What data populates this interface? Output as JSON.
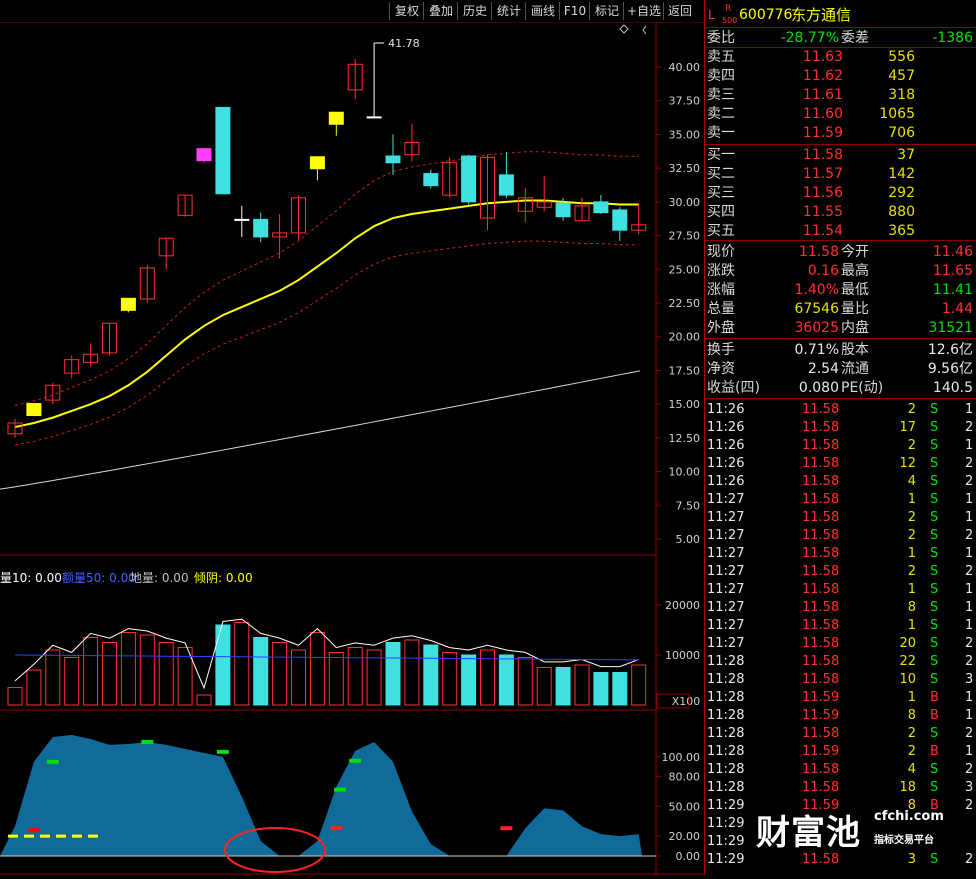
{
  "toolbar": {
    "items": [
      "复权",
      "叠加",
      "历史",
      "统计",
      "画线",
      "F10",
      "标记",
      "+自选",
      "返回"
    ]
  },
  "stock": {
    "level_badge": "L",
    "r_badge": "R",
    "sub_badge": "500",
    "code": "600776",
    "name": "东方通信"
  },
  "summary": {
    "weibi_label": "委比",
    "weibi_value": "-28.77%",
    "weicha_label": "委差",
    "weicha_value": "-1386"
  },
  "sell": [
    {
      "label": "卖五",
      "price": "11.63",
      "volume": "556"
    },
    {
      "label": "卖四",
      "price": "11.62",
      "volume": "457"
    },
    {
      "label": "卖三",
      "price": "11.61",
      "volume": "318"
    },
    {
      "label": "卖二",
      "price": "11.60",
      "volume": "1065"
    },
    {
      "label": "卖一",
      "price": "11.59",
      "volume": "706"
    }
  ],
  "buy": [
    {
      "label": "买一",
      "price": "11.58",
      "volume": "37"
    },
    {
      "label": "买二",
      "price": "11.57",
      "volume": "142"
    },
    {
      "label": "买三",
      "price": "11.56",
      "volume": "292"
    },
    {
      "label": "买四",
      "price": "11.55",
      "volume": "880"
    },
    {
      "label": "买五",
      "price": "11.54",
      "volume": "365"
    }
  ],
  "stats1": [
    {
      "l1": "现价",
      "v1": "11.58",
      "c1": "red",
      "l2": "今开",
      "v2": "11.46",
      "c2": "red"
    },
    {
      "l1": "涨跌",
      "v1": "0.16",
      "c1": "red",
      "l2": "最高",
      "v2": "11.65",
      "c2": "red"
    },
    {
      "l1": "涨幅",
      "v1": "1.40%",
      "c1": "red",
      "l2": "最低",
      "v2": "11.41",
      "c2": "green"
    },
    {
      "l1": "总量",
      "v1": "67546",
      "c1": "yellow",
      "l2": "量比",
      "v2": "1.44",
      "c2": "red"
    },
    {
      "l1": "外盘",
      "v1": "36025",
      "c1": "red",
      "l2": "内盘",
      "v2": "31521",
      "c2": "green"
    }
  ],
  "stats2": [
    {
      "l1": "换手",
      "v1": "0.71%",
      "l2": "股本",
      "v2": "12.6亿"
    },
    {
      "l1": "净资",
      "v1": "2.54",
      "l2": "流通",
      "v2": "9.56亿"
    },
    {
      "l1": "收益(四)",
      "v1": "0.080",
      "l2": "PE(动)",
      "v2": "140.5"
    }
  ],
  "ticks": [
    {
      "t": "11:26",
      "p": "11.58",
      "v": "2",
      "s": "S",
      "n": "1"
    },
    {
      "t": "11:26",
      "p": "11.58",
      "v": "17",
      "s": "S",
      "n": "2"
    },
    {
      "t": "11:26",
      "p": "11.58",
      "v": "2",
      "s": "S",
      "n": "1"
    },
    {
      "t": "11:26",
      "p": "11.58",
      "v": "12",
      "s": "S",
      "n": "2"
    },
    {
      "t": "11:26",
      "p": "11.58",
      "v": "4",
      "s": "S",
      "n": "2"
    },
    {
      "t": "11:27",
      "p": "11.58",
      "v": "1",
      "s": "S",
      "n": "1"
    },
    {
      "t": "11:27",
      "p": "11.58",
      "v": "2",
      "s": "S",
      "n": "1"
    },
    {
      "t": "11:27",
      "p": "11.58",
      "v": "2",
      "s": "S",
      "n": "2"
    },
    {
      "t": "11:27",
      "p": "11.58",
      "v": "1",
      "s": "S",
      "n": "1"
    },
    {
      "t": "11:27",
      "p": "11.58",
      "v": "2",
      "s": "S",
      "n": "2"
    },
    {
      "t": "11:27",
      "p": "11.58",
      "v": "1",
      "s": "S",
      "n": "1"
    },
    {
      "t": "11:27",
      "p": "11.58",
      "v": "8",
      "s": "S",
      "n": "1"
    },
    {
      "t": "11:27",
      "p": "11.58",
      "v": "1",
      "s": "S",
      "n": "1"
    },
    {
      "t": "11:27",
      "p": "11.58",
      "v": "20",
      "s": "S",
      "n": "2"
    },
    {
      "t": "11:28",
      "p": "11.58",
      "v": "22",
      "s": "S",
      "n": "2"
    },
    {
      "t": "11:28",
      "p": "11.58",
      "v": "10",
      "s": "S",
      "n": "3"
    },
    {
      "t": "11:28",
      "p": "11.59",
      "v": "1",
      "s": "B",
      "n": "1"
    },
    {
      "t": "11:28",
      "p": "11.59",
      "v": "8",
      "s": "B",
      "n": "1"
    },
    {
      "t": "11:28",
      "p": "11.58",
      "v": "2",
      "s": "S",
      "n": "2"
    },
    {
      "t": "11:28",
      "p": "11.59",
      "v": "2",
      "s": "B",
      "n": "1"
    },
    {
      "t": "11:28",
      "p": "11.58",
      "v": "4",
      "s": "S",
      "n": "2"
    },
    {
      "t": "11:28",
      "p": "11.58",
      "v": "18",
      "s": "S",
      "n": "3"
    },
    {
      "t": "11:29",
      "p": "11.59",
      "v": "8",
      "s": "B",
      "n": "2"
    },
    {
      "t": "11:29",
      "p": "",
      "v": "",
      "s": "",
      "n": ""
    },
    {
      "t": "11:29",
      "p": "",
      "v": "",
      "s": "",
      "n": ""
    },
    {
      "t": "11:29",
      "p": "11.58",
      "v": "3",
      "s": "S",
      "n": "2"
    }
  ],
  "price_axis": [
    "40.00",
    "37.50",
    "35.00",
    "32.50",
    "30.00",
    "27.50",
    "25.00",
    "22.50",
    "20.00",
    "17.50",
    "15.00",
    "12.50",
    "10.00",
    "7.50",
    "5.00"
  ],
  "high_marker": "41.78",
  "volume_legend": [
    {
      "text": "量10: 0.00",
      "color": "#ffffff"
    },
    {
      "text": "额量50: 0.00",
      "color": "#4060ff"
    },
    {
      "text": "地量: 0.00",
      "color": "#c0c0c0"
    },
    {
      "text": "倾阴: 0.00",
      "color": "#ffff00"
    }
  ],
  "volume_axis": [
    "20000",
    "10000"
  ],
  "volume_unit": "X100",
  "indicator_axis": [
    "100.00",
    "80.00",
    "50.00",
    "20.00",
    "0.00"
  ],
  "watermark": {
    "logo": "财富池",
    "site": "cfchi.com",
    "slogan": "指标交易平台"
  },
  "chart_data": {
    "type": "candlestick",
    "candles": [
      {
        "o": 12.8,
        "c": 13.6,
        "h": 13.9,
        "l": 12.5
      },
      {
        "o": 14.6,
        "c": 14.6,
        "h": 15.0,
        "l": 14.2,
        "flag": "yellow"
      },
      {
        "o": 15.3,
        "c": 16.4,
        "h": 16.6,
        "l": 15.0
      },
      {
        "o": 17.3,
        "c": 18.3,
        "h": 18.6,
        "l": 16.9
      },
      {
        "o": 18.1,
        "c": 18.7,
        "h": 19.5,
        "l": 17.8
      },
      {
        "o": 18.8,
        "c": 21.0,
        "h": 21.0,
        "l": 18.6
      },
      {
        "o": 22.4,
        "c": 22.4,
        "h": 22.7,
        "l": 21.8,
        "flag": "yellow"
      },
      {
        "o": 22.8,
        "c": 25.1,
        "h": 25.3,
        "l": 22.5
      },
      {
        "o": 26.0,
        "c": 27.3,
        "h": 27.3,
        "l": 25.0
      },
      {
        "o": 29.0,
        "c": 30.5,
        "h": 30.5,
        "l": 28.9
      },
      {
        "o": 33.5,
        "c": 33.5,
        "h": 33.9,
        "l": 32.9,
        "flag": "pink"
      },
      {
        "o": 37.0,
        "c": 30.6,
        "h": 37.0,
        "l": 30.6
      },
      {
        "o": 28.7,
        "c": 28.7,
        "h": 29.7,
        "l": 27.4,
        "flag": "white"
      },
      {
        "o": 28.7,
        "c": 27.4,
        "h": 29.2,
        "l": 27.0
      },
      {
        "o": 27.4,
        "c": 27.7,
        "h": 29.1,
        "l": 25.8
      },
      {
        "o": 27.7,
        "c": 30.3,
        "h": 30.5,
        "l": 27.2
      },
      {
        "o": 32.9,
        "c": 32.9,
        "h": 33.1,
        "l": 31.6,
        "flag": "yellow"
      },
      {
        "o": 36.2,
        "c": 36.2,
        "h": 36.6,
        "l": 34.9,
        "flag": "yellow"
      },
      {
        "o": 38.3,
        "c": 40.2,
        "h": 40.6,
        "l": 37.6
      },
      {
        "o": 36.3,
        "c": 36.3,
        "h": 41.78,
        "l": 36.3,
        "flag": "white"
      },
      {
        "o": 33.4,
        "c": 32.9,
        "h": 35.0,
        "l": 32.0
      },
      {
        "o": 33.5,
        "c": 34.4,
        "h": 35.8,
        "l": 33.0
      },
      {
        "o": 32.1,
        "c": 31.2,
        "h": 32.4,
        "l": 31.0
      },
      {
        "o": 30.5,
        "c": 32.9,
        "h": 33.3,
        "l": 30.3
      },
      {
        "o": 33.4,
        "c": 30.0,
        "h": 33.5,
        "l": 29.8
      },
      {
        "o": 28.8,
        "c": 33.3,
        "h": 33.5,
        "l": 27.9
      },
      {
        "o": 32.0,
        "c": 30.5,
        "h": 33.7,
        "l": 30.3
      },
      {
        "o": 29.3,
        "c": 30.3,
        "h": 31.0,
        "l": 28.5
      },
      {
        "o": 29.6,
        "c": 30.0,
        "h": 31.9,
        "l": 29.3
      },
      {
        "o": 29.9,
        "c": 28.9,
        "h": 30.3,
        "l": 28.6
      },
      {
        "o": 28.6,
        "c": 29.7,
        "h": 30.3,
        "l": 28.6
      },
      {
        "o": 30.0,
        "c": 29.2,
        "h": 30.5,
        "l": 29.1
      },
      {
        "o": 29.4,
        "c": 27.9,
        "h": 29.6,
        "l": 27.1
      },
      {
        "o": 27.9,
        "c": 28.3,
        "h": 29.9,
        "l": 27.6
      }
    ],
    "ylim": [
      5,
      41.78
    ]
  }
}
